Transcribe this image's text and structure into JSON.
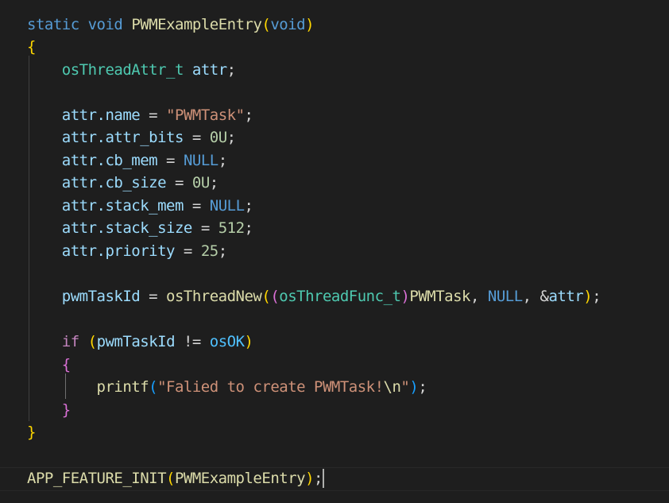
{
  "editor": {
    "theme_colors": {
      "background": "#1e1e1e",
      "keyword": "#569cd6",
      "function": "#dcdcaa",
      "type": "#4ec9b0",
      "variable": "#9cdcfe",
      "string": "#ce9178",
      "number": "#b5cea8",
      "bracket_gold": "#ffd700",
      "bracket_purple": "#da70d6",
      "bracket_blue": "#179fff"
    },
    "tokens": {
      "l1_static": "static",
      "l1_void": "void",
      "l1_fname": "PWMExampleEntry",
      "l1_paren_open": "(",
      "l1_void_param": "void",
      "l1_paren_close": ")",
      "l2_brace": "{",
      "l3_type": "osThreadAttr_t",
      "l3_var": "attr",
      "l3_semi": ";",
      "l5_obj": "attr",
      "l5_field": ".name",
      "l5_eq": " = ",
      "l5_val": "\"PWMTask\"",
      "l5_semi": ";",
      "l6_obj": "attr",
      "l6_field": ".attr_bits",
      "l6_eq": " = ",
      "l6_val": "0U",
      "l6_semi": ";",
      "l7_obj": "attr",
      "l7_field": ".cb_mem",
      "l7_eq": " = ",
      "l7_val": "NULL",
      "l7_semi": ";",
      "l8_obj": "attr",
      "l8_field": ".cb_size",
      "l8_eq": " = ",
      "l8_val": "0U",
      "l8_semi": ";",
      "l9_obj": "attr",
      "l9_field": ".stack_mem",
      "l9_eq": " = ",
      "l9_val": "NULL",
      "l9_semi": ";",
      "l10_obj": "attr",
      "l10_field": ".stack_size",
      "l10_eq": " = ",
      "l10_val": "512",
      "l10_semi": ";",
      "l11_obj": "attr",
      "l11_field": ".priority",
      "l11_eq": " = ",
      "l11_val": "25",
      "l11_semi": ";",
      "l13_var": "pwmTaskId",
      "l13_eq": " = ",
      "l13_fn": "osThreadNew",
      "l13_p1": "(",
      "l13_p2": "(",
      "l13_cast": "osThreadFunc_t",
      "l13_p2c": ")",
      "l13_arg1": "PWMTask",
      "l13_comma1": ", ",
      "l13_null": "NULL",
      "l13_comma2": ", ",
      "l13_amp": "&",
      "l13_attr": "attr",
      "l13_p1c": ")",
      "l13_semi": ";",
      "l15_if": "if",
      "l15_sp": " ",
      "l15_p": "(",
      "l15_var": "pwmTaskId",
      "l15_neq": " != ",
      "l15_const": "osOK",
      "l15_pc": ")",
      "l16_brace": "{",
      "l17_fn": "printf",
      "l17_p": "(",
      "l17_str": "\"Falied to create PWMTask!",
      "l17_esc": "\\n",
      "l17_strend": "\"",
      "l17_pc": ")",
      "l17_semi": ";",
      "l18_brace": "}",
      "l19_brace": "}",
      "l21_macro": "APP_FEATURE_INIT",
      "l21_p": "(",
      "l21_arg": "PWMExampleEntry",
      "l21_pc": ")",
      "l21_semi": ";"
    }
  }
}
